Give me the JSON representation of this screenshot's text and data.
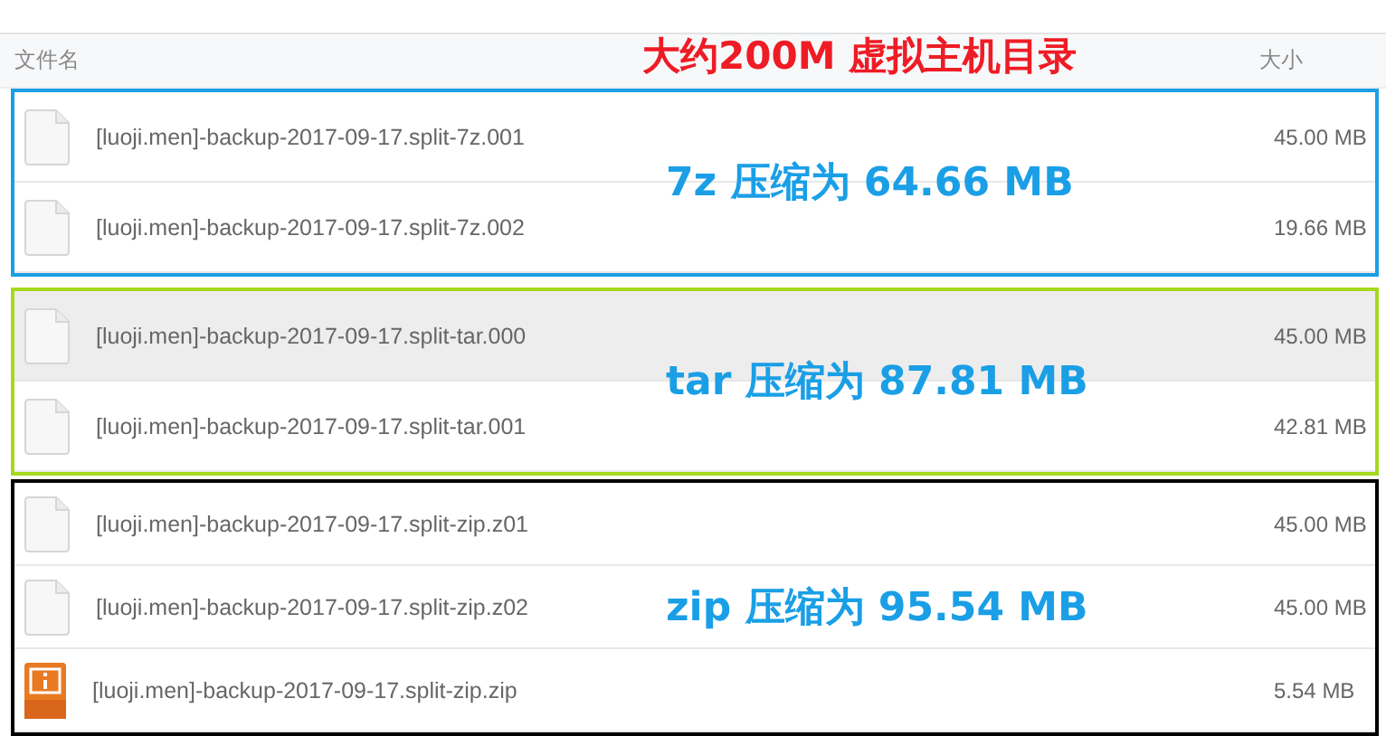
{
  "annotation": {
    "title": "大约200M 虚拟主机目录"
  },
  "columns": [
    {
      "label": "文件名"
    },
    {
      "label": "大小"
    }
  ],
  "groups": [
    {
      "color": "#1a9fe6",
      "label": "7z 压缩为 64.66 MB",
      "files": [
        {
          "name": "[luoji.men]-backup-2017-09-17.split-7z.001",
          "size": "45.00 MB",
          "kind": "file",
          "selected": false
        },
        {
          "name": "[luoji.men]-backup-2017-09-17.split-7z.002",
          "size": "19.66 MB",
          "kind": "file",
          "selected": false
        }
      ]
    },
    {
      "color": "#a6d81e",
      "label": "tar 压缩为 87.81 MB",
      "files": [
        {
          "name": "[luoji.men]-backup-2017-09-17.split-tar.000",
          "size": "45.00 MB",
          "kind": "file",
          "selected": true
        },
        {
          "name": "[luoji.men]-backup-2017-09-17.split-tar.001",
          "size": "42.81 MB",
          "kind": "file",
          "selected": false
        }
      ]
    },
    {
      "color": "#000000",
      "label": "zip 压缩为 95.54 MB",
      "files": [
        {
          "name": "[luoji.men]-backup-2017-09-17.split-zip.z01",
          "size": "45.00 MB",
          "kind": "file",
          "selected": false
        },
        {
          "name": "[luoji.men]-backup-2017-09-17.split-zip.z02",
          "size": "45.00 MB",
          "kind": "file",
          "selected": false
        },
        {
          "name": "[luoji.men]-backup-2017-09-17.split-zip.zip",
          "size": "5.54 MB",
          "kind": "zip",
          "selected": false
        }
      ]
    }
  ]
}
